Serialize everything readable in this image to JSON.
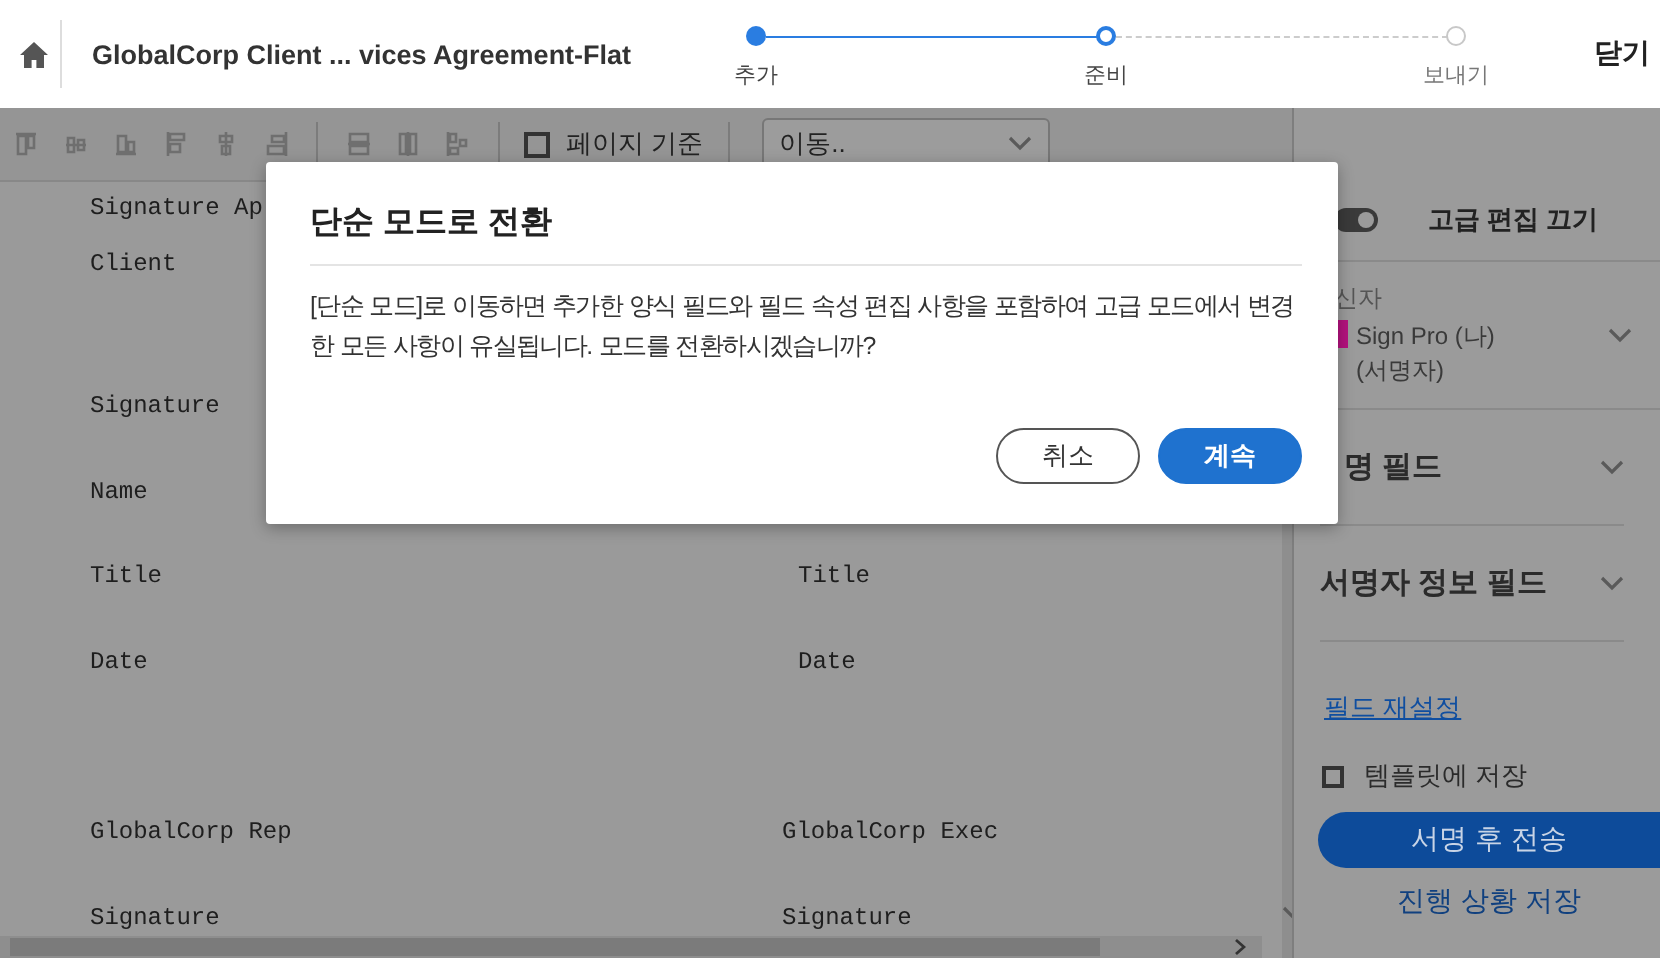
{
  "header": {
    "title": "GlobalCorp Client ... vices Agreement-Flat",
    "steps": [
      {
        "label": "추가",
        "done": true,
        "current": false
      },
      {
        "label": "준비",
        "done": false,
        "current": true
      },
      {
        "label": "보내기",
        "done": false,
        "current": false
      }
    ],
    "close": "닫기"
  },
  "toolbar": {
    "page_basis": {
      "label": "페이지 기준",
      "checked": false
    },
    "move_select": {
      "value": "이동.."
    }
  },
  "document": {
    "rows": [
      {
        "left": "Signature Ap"
      },
      {
        "left": "Client"
      },
      {
        "left": "Signature"
      },
      {
        "left": "Name"
      },
      {
        "left": "Title",
        "right": "Title"
      },
      {
        "left": "Date",
        "right": "Date"
      },
      {
        "left": "GlobalCorp Rep",
        "right": "GlobalCorp Exec"
      },
      {
        "left": "Signature",
        "right": "Signature"
      }
    ]
  },
  "sidebar": {
    "advanced_toggle": {
      "label": "고급 편집 끄기",
      "on": true
    },
    "recipients": {
      "heading": "신자",
      "name": "Sign Pro (나)",
      "role": "(서명자)",
      "color": "#b4127e"
    },
    "sections": [
      {
        "label": "명 필드",
        "expanded": false
      },
      {
        "label": "서명자 정보 필드",
        "expanded": false
      }
    ],
    "reset_link": "필드 재설정",
    "save_template": {
      "label": "템플릿에 저장",
      "checked": false
    },
    "send_button": "서명 후 전송",
    "save_progress": "진행 상황 저장"
  },
  "dialog": {
    "title": "단순 모드로 전환",
    "message": "[단순 모드]로 이동하면 추가한 양식 필드와 필드 속성 편집 사항을 포함하여 고급 모드에서 변경한 모든 사항이 유실됩니다. 모드를 전환하시겠습니까?",
    "buttons": [
      {
        "label": "취소",
        "kind": "secondary"
      },
      {
        "label": "계속",
        "kind": "primary"
      }
    ]
  }
}
